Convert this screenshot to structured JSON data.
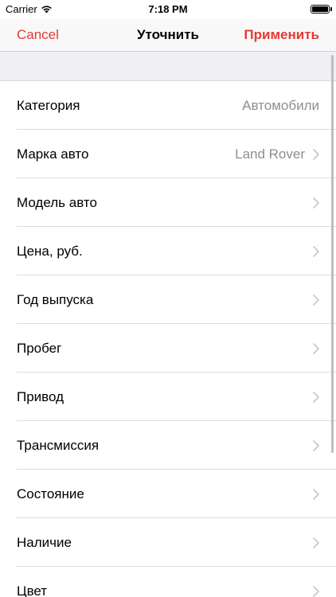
{
  "status_bar": {
    "carrier": "Carrier",
    "time": "7:18 PM",
    "wifi_icon": "wifi-icon",
    "battery_level": 1.0
  },
  "nav": {
    "cancel": "Cancel",
    "title": "Уточнить",
    "apply": "Применить",
    "accent_color": "#e53935"
  },
  "rows": [
    {
      "label": "Категория",
      "value": "Автомобили",
      "chevron": false
    },
    {
      "label": "Марка авто",
      "value": "Land Rover",
      "chevron": true
    },
    {
      "label": "Модель авто",
      "value": "",
      "chevron": true
    },
    {
      "label": "Цена, руб.",
      "value": "",
      "chevron": true
    },
    {
      "label": "Год выпуска",
      "value": "",
      "chevron": true
    },
    {
      "label": "Пробег",
      "value": "",
      "chevron": true
    },
    {
      "label": "Привод",
      "value": "",
      "chevron": true
    },
    {
      "label": "Трансмиссия",
      "value": "",
      "chevron": true
    },
    {
      "label": "Состояние",
      "value": "",
      "chevron": true
    },
    {
      "label": "Наличие",
      "value": "",
      "chevron": true
    },
    {
      "label": "Цвет",
      "value": "",
      "chevron": true
    }
  ]
}
